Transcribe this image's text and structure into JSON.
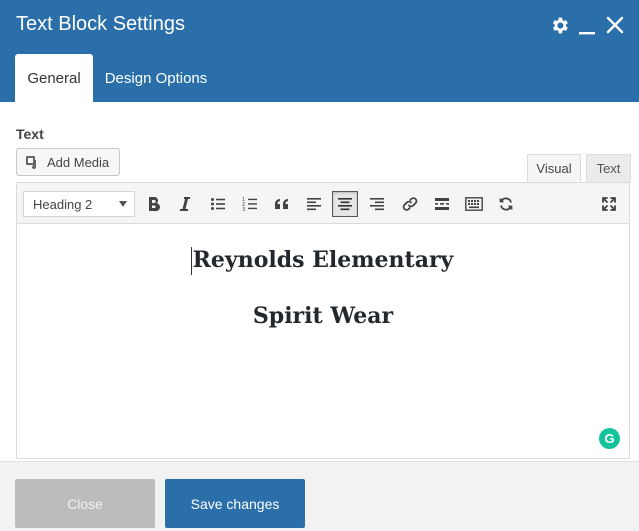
{
  "window": {
    "title": "Text Block Settings",
    "icons": [
      "gear-icon",
      "minimize-icon",
      "close-icon"
    ]
  },
  "tabs": [
    {
      "label": "General",
      "active": true
    },
    {
      "label": "Design Options",
      "active": false
    }
  ],
  "field": {
    "label": "Text",
    "add_media_label": "Add Media"
  },
  "editor_modes": {
    "visual": "Visual",
    "text": "Text",
    "active": "visual"
  },
  "toolbar": {
    "format_selected": "Heading 2",
    "buttons": [
      "bold-icon",
      "italic-icon",
      "bullet-list-icon",
      "numbered-list-icon",
      "blockquote-icon",
      "align-left-icon",
      "align-center-icon",
      "align-right-icon",
      "link-icon",
      "read-more-icon",
      "toolbar-toggle-icon",
      "refresh-icon",
      "fullscreen-icon"
    ],
    "pressed": "align-center-icon"
  },
  "content": {
    "lines": [
      "Reynolds Elementary",
      "Spirit Wear"
    ],
    "grammarly_badge": "G"
  },
  "footer": {
    "close_label": "Close",
    "save_label": "Save changes"
  },
  "colors": {
    "header": "#2a6faa",
    "save_button": "#2a6faa",
    "close_button": "#bcbcbc",
    "grammarly": "#15c39a"
  }
}
